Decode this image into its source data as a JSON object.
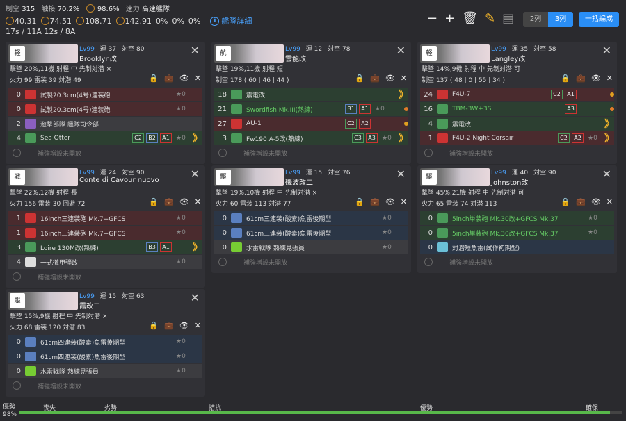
{
  "header": {
    "stats": [
      {
        "k": "制空",
        "v": "315"
      },
      {
        "k": "触接",
        "v": "70.2%"
      },
      {
        "k": "",
        "v": "98.6%"
      },
      {
        "k": "速力",
        "v": "高速艦隊"
      }
    ],
    "los": [
      "40.31",
      "74.51",
      "108.71",
      "142.91"
    ],
    "cond": [
      "0%",
      "0%",
      "0%"
    ],
    "tp": "17s / 11A",
    "tp2": "12s / 8A",
    "info_label": "艦隊詳細",
    "col2": "2列",
    "col3": "3列",
    "edit_all": "一括編成"
  },
  "ships": [
    {
      "type": "軽",
      "lv": "Lv99",
      "luck": "運 37",
      "aa": "対空 80",
      "name": "Brooklyn改",
      "s1": "撃墜 20%,11機  射程 中  先制対潜 ×",
      "s2": "火力 99  雷装 39  対潜 49",
      "slots": [
        {
          "c": "0",
          "t": "試製20.3cm(4号)連装砲",
          "cls": "red",
          "ic": "#c33",
          "star": "★0"
        },
        {
          "c": "0",
          "t": "試製20.3cm(4号)連装砲",
          "cls": "red",
          "ic": "#c33",
          "star": "★0"
        },
        {
          "c": "2",
          "t": "遊撃部隊 艦隊司令部",
          "cls": "gray",
          "ic": "#8a5fbf",
          "star": ""
        },
        {
          "c": "4",
          "t": "Sea Otter",
          "cls": "green",
          "ic": "#4a9a5a",
          "star": "★0",
          "b": [
            "C2",
            "B2",
            "A1"
          ],
          "chev": "》"
        }
      ],
      "expand": "補強増設未開放"
    },
    {
      "type": "航",
      "lv": "Lv99",
      "luck": "運 12",
      "aa": "対空 78",
      "name": "雲龍改",
      "s1": "撃墜 19%,11機  射程 短",
      "s2": "制空 178 ( 60 | 46 | 44 )",
      "slots": [
        {
          "c": "18",
          "t": "震電改",
          "cls": "green",
          "ic": "#4a9a5a",
          "star": "",
          "chev": "》"
        },
        {
          "c": "21",
          "t": "Swordfish Mk.III(熟練)",
          "cls": "green",
          "ic": "#4a9a5a",
          "star": "★0",
          "b": [
            "B1",
            "A1"
          ],
          "dot": "#e07b2a",
          "g": true
        },
        {
          "c": "27",
          "t": "AU-1",
          "cls": "red",
          "ic": "#c33",
          "star": "",
          "b": [
            "C2",
            "A2"
          ],
          "dot": "#e0a020"
        },
        {
          "c": "3",
          "t": "Fw190 A-5改(熟練)",
          "cls": "green",
          "ic": "#4a9a5a",
          "star": "★0",
          "b": [
            "C3",
            "A3"
          ],
          "chev": "》"
        }
      ],
      "expand": "補強増設未開放"
    },
    {
      "type": "軽",
      "lv": "Lv99",
      "luck": "運 35",
      "aa": "対空 58",
      "name": "Langley改",
      "s1": "撃墜 14%,9機  射程 中  先制対潜 可",
      "s2": "制空 137 ( 48 | 0 | 55 | 34 )",
      "slots": [
        {
          "c": "24",
          "t": "F4U-7",
          "cls": "red",
          "ic": "#c33",
          "star": "",
          "b": [
            "C2",
            "A1"
          ],
          "dot": "#e0a020"
        },
        {
          "c": "16",
          "t": "TBM-3W+3S",
          "cls": "green",
          "ic": "#4a9a5a",
          "star": "",
          "b": [
            "A3"
          ],
          "dot": "#e07b2a",
          "g": true
        },
        {
          "c": "4",
          "t": "震電改",
          "cls": "green",
          "ic": "#4a9a5a",
          "star": "",
          "chev": "》"
        },
        {
          "c": "1",
          "t": "F4U-2 Night Corsair",
          "cls": "red",
          "ic": "#c33",
          "star": "★0",
          "b": [
            "C2",
            "A2"
          ],
          "chev": "》"
        }
      ],
      "expand": "補強増設未開放"
    },
    {
      "type": "戦",
      "lv": "Lv99",
      "luck": "運 24",
      "aa": "対空 90",
      "name": "Conte di Cavour nuovo",
      "s1": "撃墜 22%,12機  射程 長",
      "s2": "火力 156  雷装 30  回避 72",
      "slots": [
        {
          "c": "1",
          "t": "16inch三連装砲 Mk.7+GFCS",
          "cls": "red",
          "ic": "#c33",
          "star": "★0"
        },
        {
          "c": "1",
          "t": "16inch三連装砲 Mk.7+GFCS",
          "cls": "red",
          "ic": "#c33",
          "star": "★0"
        },
        {
          "c": "3",
          "t": "Loire 130M改(熟練)",
          "cls": "green",
          "ic": "#4a9a5a",
          "star": "",
          "b": [
            "B3",
            "A1"
          ],
          "chev": "》"
        },
        {
          "c": "4",
          "t": "一式徹甲弾改",
          "cls": "gray",
          "ic": "#ddd",
          "star": "★0"
        }
      ],
      "expand": "補強増設未開放"
    },
    {
      "type": "駆",
      "lv": "Lv99",
      "luck": "運 15",
      "aa": "対空 76",
      "name": "磯波改二",
      "s1": "撃墜 19%,10機  射程 中  先制対潜 ×",
      "s2": "火力 60  雷装 113  対潜 77",
      "slots": [
        {
          "c": "0",
          "t": "61cm三連装(酸素)魚雷後期型",
          "cls": "blue",
          "ic": "#5a7fbf",
          "star": "★0"
        },
        {
          "c": "0",
          "t": "61cm三連装(酸素)魚雷後期型",
          "cls": "blue",
          "ic": "#5a7fbf",
          "star": "★0"
        },
        {
          "c": "0",
          "t": "水雷戦隊 熟練見張員",
          "cls": "gray",
          "ic": "#7c3",
          "star": "★0"
        }
      ],
      "expand": "補強増設未開放"
    },
    {
      "type": "駆",
      "lv": "Lv99",
      "luck": "運 40",
      "aa": "対空 90",
      "name": "Johnston改",
      "s1": "撃墜 45%,21機  射程 中  先制対潜 可",
      "s2": "火力 65  雷装 74  対潜 113",
      "slots": [
        {
          "c": "0",
          "t": "5inch単装砲 Mk.30改+GFCS Mk.37",
          "cls": "green",
          "ic": "#4a9a5a",
          "star": "★0",
          "g": true
        },
        {
          "c": "0",
          "t": "5inch単装砲 Mk.30改+GFCS Mk.37",
          "cls": "green",
          "ic": "#4a9a5a",
          "star": "★0",
          "g": true
        },
        {
          "c": "0",
          "t": "対潜短魚雷(試作初期型)",
          "cls": "blue",
          "ic": "#6bbfd6",
          "star": ""
        }
      ],
      "expand": "補強増設未開放"
    },
    {
      "type": "駆",
      "lv": "Lv99",
      "luck": "運 15",
      "aa": "対空 63",
      "name": "霞改二",
      "s1": "撃墜 15%,9機  射程 中  先制対潜 ×",
      "s2": "火力 68  雷装 120  対潜 83",
      "slots": [
        {
          "c": "0",
          "t": "61cm四連装(酸素)魚雷後期型",
          "cls": "blue",
          "ic": "#5a7fbf",
          "star": "★0"
        },
        {
          "c": "0",
          "t": "61cm四連装(酸素)魚雷後期型",
          "cls": "blue",
          "ic": "#5a7fbf",
          "star": "★0"
        },
        {
          "c": "0",
          "t": "水雷戦隊 熟練見張員",
          "cls": "gray",
          "ic": "#7c3",
          "star": "★0"
        }
      ],
      "expand": "補強増設未開放"
    }
  ],
  "airbar": {
    "left": "優勢",
    "pct": "98%",
    "labels": [
      "喪失",
      "劣勢",
      "拮抗",
      "優勢",
      "確保"
    ],
    "fill": 0.98
  }
}
